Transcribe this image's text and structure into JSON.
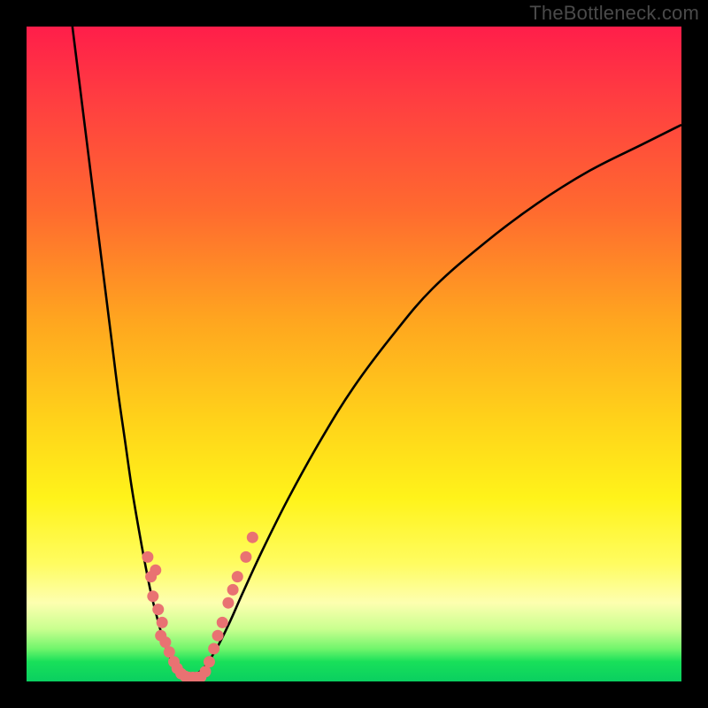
{
  "watermark": "TheBottleneck.com",
  "chart_data": {
    "type": "line",
    "title": "",
    "xlabel": "",
    "ylabel": "",
    "xlim": [
      0,
      100
    ],
    "ylim": [
      0,
      100
    ],
    "grid": false,
    "legend": false,
    "series": [
      {
        "name": "left-curve",
        "x": [
          7,
          8,
          9,
          10,
          11,
          12,
          13,
          14,
          15,
          16,
          17,
          18,
          19,
          20,
          21,
          22,
          23,
          24,
          25
        ],
        "y": [
          100,
          92,
          84,
          76,
          68,
          60,
          52,
          44,
          37,
          30,
          24,
          18.5,
          13.5,
          9.5,
          6,
          3.5,
          2,
          1,
          0.5
        ]
      },
      {
        "name": "right-curve",
        "x": [
          25,
          27,
          29,
          31,
          33,
          36,
          40,
          45,
          50,
          56,
          62,
          70,
          78,
          86,
          94,
          100
        ],
        "y": [
          0.5,
          2,
          5,
          9,
          13.5,
          20,
          28,
          37,
          45,
          53,
          60,
          67,
          73,
          78,
          82,
          85
        ]
      }
    ],
    "scatter_points": {
      "name": "highlight-points",
      "color": "#e97272",
      "points": [
        {
          "x": 18.5,
          "y": 19
        },
        {
          "x": 19.0,
          "y": 16
        },
        {
          "x": 19.7,
          "y": 17
        },
        {
          "x": 19.3,
          "y": 13
        },
        {
          "x": 20.1,
          "y": 11
        },
        {
          "x": 20.7,
          "y": 9
        },
        {
          "x": 20.5,
          "y": 7
        },
        {
          "x": 21.2,
          "y": 6
        },
        {
          "x": 21.8,
          "y": 4.5
        },
        {
          "x": 22.5,
          "y": 3
        },
        {
          "x": 23.0,
          "y": 2
        },
        {
          "x": 23.6,
          "y": 1.2
        },
        {
          "x": 24.2,
          "y": 0.8
        },
        {
          "x": 24.8,
          "y": 0.6
        },
        {
          "x": 25.4,
          "y": 0.6
        },
        {
          "x": 26.0,
          "y": 0.6
        },
        {
          "x": 26.6,
          "y": 0.7
        },
        {
          "x": 27.3,
          "y": 1.5
        },
        {
          "x": 27.9,
          "y": 3
        },
        {
          "x": 28.6,
          "y": 5
        },
        {
          "x": 29.2,
          "y": 7
        },
        {
          "x": 29.9,
          "y": 9
        },
        {
          "x": 30.8,
          "y": 12
        },
        {
          "x": 31.5,
          "y": 14
        },
        {
          "x": 32.2,
          "y": 16
        },
        {
          "x": 33.5,
          "y": 19
        },
        {
          "x": 34.5,
          "y": 22
        }
      ]
    }
  }
}
